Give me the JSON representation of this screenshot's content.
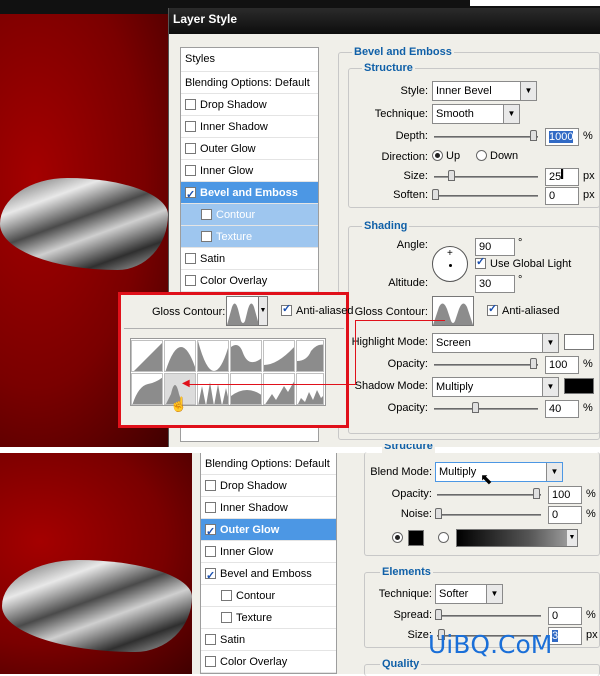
{
  "dialog_top": {
    "title": "Layer Style",
    "styles_header": "Styles",
    "style_items": [
      {
        "label": "Blending Options: Default",
        "checkbox": false,
        "selected": false
      },
      {
        "label": "Drop Shadow",
        "checkbox": true,
        "checked": false
      },
      {
        "label": "Inner Shadow",
        "checkbox": true,
        "checked": false
      },
      {
        "label": "Outer Glow",
        "checkbox": true,
        "checked": false
      },
      {
        "label": "Inner Glow",
        "checkbox": true,
        "checked": false
      },
      {
        "label": "Bevel and Emboss",
        "checkbox": true,
        "checked": true,
        "selected": true
      },
      {
        "label": "Contour",
        "checkbox": true,
        "checked": false,
        "sub": true
      },
      {
        "label": "Texture",
        "checkbox": true,
        "checked": false,
        "sub": true
      },
      {
        "label": "Satin",
        "checkbox": true,
        "checked": false
      },
      {
        "label": "Color Overlay",
        "checkbox": true,
        "checked": false
      }
    ],
    "bevel_title": "Bevel and Emboss",
    "structure_title": "Structure",
    "style_label": "Style:",
    "style_value": "Inner Bevel",
    "technique_label": "Technique:",
    "technique_value": "Smooth",
    "depth_label": "Depth:",
    "depth_value": "1000",
    "depth_unit": "%",
    "direction_label": "Direction:",
    "direction_up": "Up",
    "direction_down": "Down",
    "size_label": "Size:",
    "size_value": "25",
    "size_unit": "px",
    "soften_label": "Soften:",
    "soften_value": "0",
    "soften_unit": "px",
    "shading_title": "Shading",
    "angle_label": "Angle:",
    "angle_value": "90",
    "angle_unit": "°",
    "use_global_light": "Use Global Light",
    "altitude_label": "Altitude:",
    "altitude_value": "30",
    "altitude_unit": "°",
    "gloss_contour_label": "Gloss Contour:",
    "anti_aliased": "Anti-aliased",
    "highlight_mode_label": "Highlight Mode:",
    "highlight_mode_value": "Screen",
    "highlight_color": "#ffffff",
    "opacity_label": "Opacity:",
    "highlight_opacity": "100",
    "opacity_unit": "%",
    "shadow_mode_label": "Shadow Mode:",
    "shadow_mode_value": "Multiply",
    "shadow_color": "#000000",
    "shadow_opacity": "40"
  },
  "callout": {
    "gloss_contour_label": "Gloss Contour:",
    "anti_aliased": "Anti-aliased",
    "highlight_color": "#e0101a"
  },
  "dialog_bottom": {
    "style_items": [
      {
        "label": "Blending Options: Default",
        "checkbox": false
      },
      {
        "label": "Drop Shadow",
        "checkbox": true,
        "checked": false
      },
      {
        "label": "Inner Shadow",
        "checkbox": true,
        "checked": false
      },
      {
        "label": "Outer Glow",
        "checkbox": true,
        "checked": true,
        "selected": true
      },
      {
        "label": "Inner Glow",
        "checkbox": true,
        "checked": false
      },
      {
        "label": "Bevel and Emboss",
        "checkbox": true,
        "checked": true
      },
      {
        "label": "Contour",
        "checkbox": true,
        "checked": false,
        "sub": true
      },
      {
        "label": "Texture",
        "checkbox": true,
        "checked": false,
        "sub": true
      },
      {
        "label": "Satin",
        "checkbox": true,
        "checked": false
      },
      {
        "label": "Color Overlay",
        "checkbox": true,
        "checked": false
      }
    ],
    "structure_title": "Structure",
    "blend_mode_label": "Blend Mode:",
    "blend_mode_value": "Multiply",
    "opacity_label": "Opacity:",
    "opacity_value": "100",
    "opacity_unit": "%",
    "noise_label": "Noise:",
    "noise_value": "0",
    "noise_unit": "%",
    "glow_color": "#000000",
    "elements_title": "Elements",
    "technique_label": "Technique:",
    "technique_value": "Softer",
    "spread_label": "Spread:",
    "spread_value": "0",
    "spread_unit": "%",
    "size_label": "Size:",
    "size_value": "3",
    "size_unit": "px",
    "quality_title": "Quality"
  },
  "watermark": "UiBQ.CoM",
  "colors": {
    "accent_blue": "#4c97e4",
    "callout_red": "#e0101a",
    "background_red": "#8a0000"
  }
}
